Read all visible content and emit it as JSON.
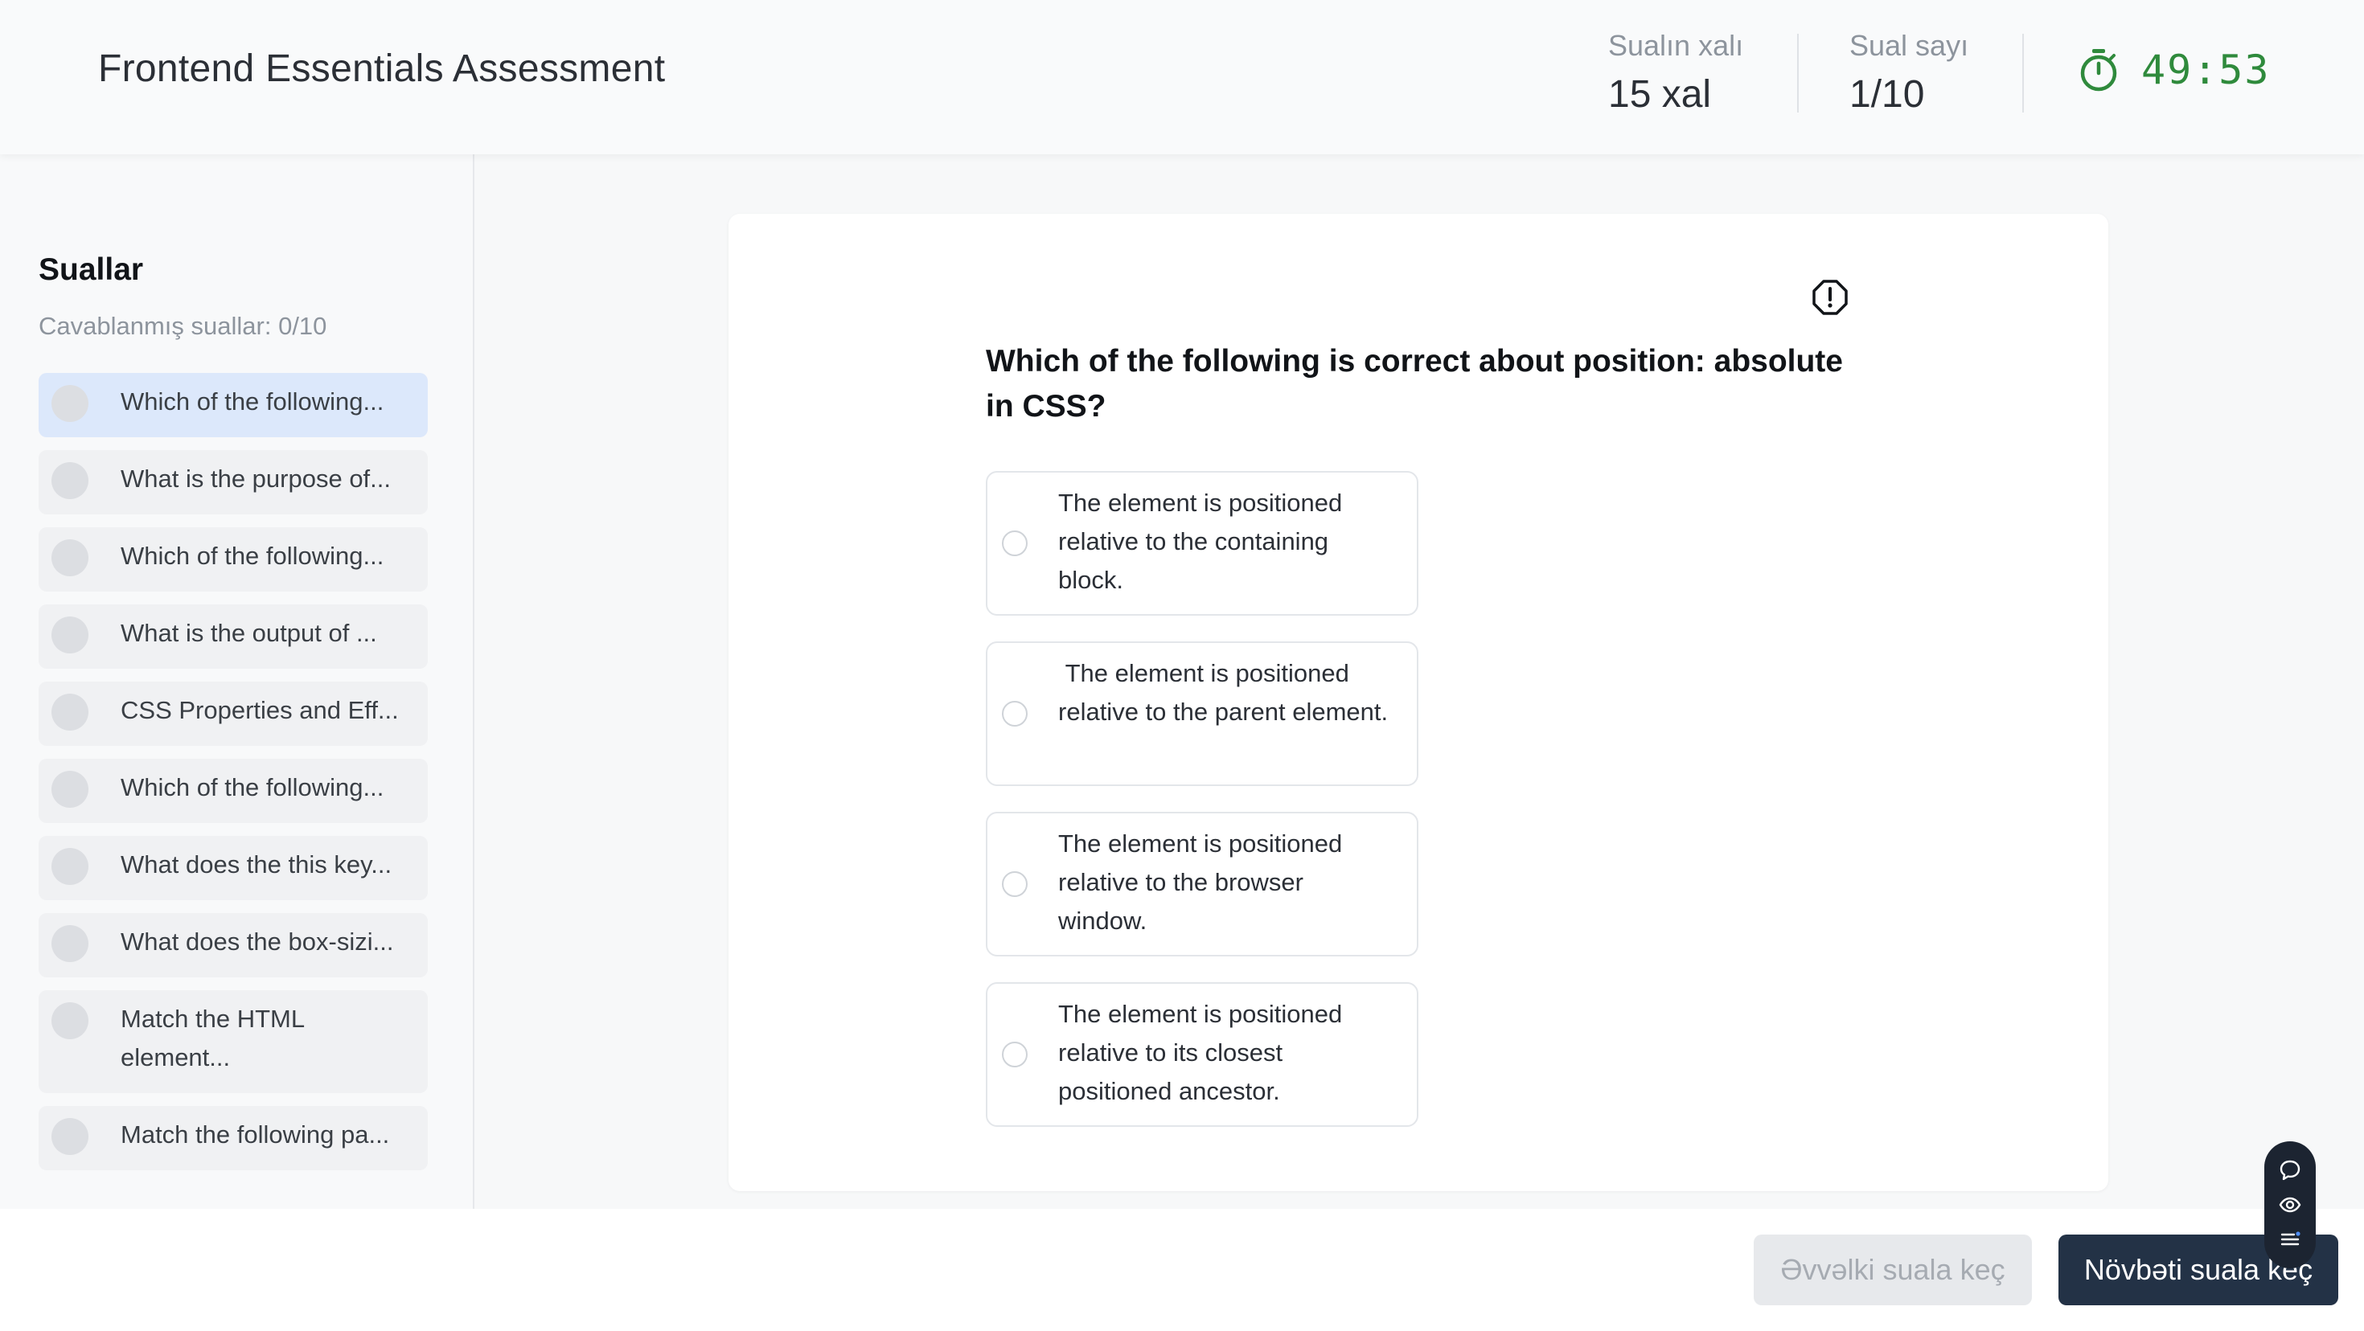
{
  "header": {
    "title": "Frontend Essentials Assessment",
    "points_label": "Sualın xalı",
    "points_value": "15 xal",
    "count_label": "Sual sayı",
    "count_value": "1/10",
    "timer": "49:53"
  },
  "sidebar": {
    "title": "Suallar",
    "answered": "Cavablanmış suallar: 0/10",
    "items": [
      {
        "label": "Which of the following..."
      },
      {
        "label": "What is the purpose of..."
      },
      {
        "label": "Which of the following..."
      },
      {
        "label": "What is the output of ..."
      },
      {
        "label": "CSS Properties and Eff..."
      },
      {
        "label": "Which of the following..."
      },
      {
        "label": "What does the this key..."
      },
      {
        "label": "What does the box-sizi..."
      },
      {
        "label": "Match the HTML element..."
      },
      {
        "label": "Match the following pa..."
      }
    ]
  },
  "question": {
    "text": "Which of the following is correct about position: absolute in CSS?",
    "options": [
      {
        "text": "The element is positioned relative to the containing block."
      },
      {
        "text": " The element is positioned relative to the parent element."
      },
      {
        "text": "The element is positioned relative to the browser window."
      },
      {
        "text": "The element is positioned relative to its closest positioned ancestor."
      }
    ]
  },
  "footer": {
    "prev_label": "Əvvəlki suala keç",
    "next_label": "Növbəti suala keç"
  },
  "icons": {
    "timer": "stopwatch-icon",
    "report": "alert-octagon-icon",
    "widget": [
      "chat-icon",
      "eye-icon",
      "list-icon"
    ]
  },
  "colors": {
    "timer": "#2f8a3c",
    "active_item": "#dce8fb",
    "primary_button": "#233246"
  }
}
